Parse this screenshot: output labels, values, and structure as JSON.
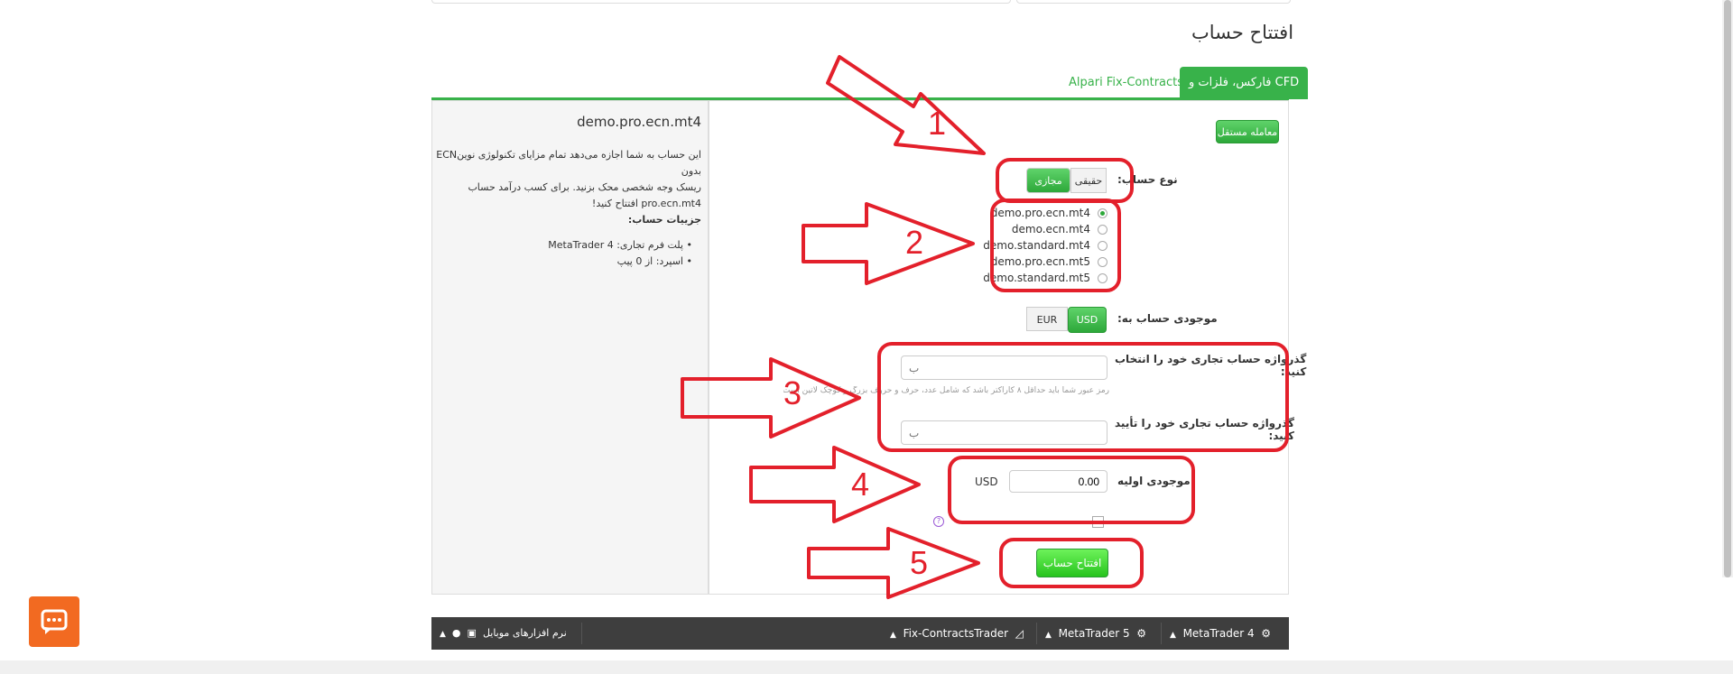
{
  "page": {
    "title": "افتتاح حساب"
  },
  "tabs": [
    {
      "label": "فارکس، فلزات و CFD",
      "active": true
    },
    {
      "label": "Alpari Fix-Contracts",
      "active": false
    }
  ],
  "trade_button": "معامله مستقل",
  "account_type": {
    "label": "نوع حساب:",
    "options": [
      "مجازی",
      "حقیقی"
    ],
    "selected": "مجازی"
  },
  "accounts": [
    {
      "label": "demo.pro.ecn.mt4",
      "selected": true
    },
    {
      "label": "demo.ecn.mt4",
      "selected": false
    },
    {
      "label": "demo.standard.mt4",
      "selected": false
    },
    {
      "label": "demo.pro.ecn.mt5",
      "selected": false
    },
    {
      "label": "demo.standard.mt5",
      "selected": false
    }
  ],
  "currency": {
    "label": "موجودی حساب به:",
    "options": [
      "USD",
      "EUR"
    ],
    "selected": "USD"
  },
  "password": {
    "label_line1": "گذرواژه حساب تجاری خود را انتخاب",
    "label_line2": "کنید:",
    "placeholder": "ب",
    "hint": "رمز عبور شما باید حداقل ۸ کاراکتر باشد که شامل عدد، حرف و حروف بزرگ و کوچک لاتین است."
  },
  "confirm_password": {
    "label_line1": "گذرواژه حساب تجاری خود را تأیید",
    "label_line2": "کنید:",
    "placeholder": "ب"
  },
  "initial_balance": {
    "label": "موجودی اولیه",
    "value": "0.00",
    "currency": "USD"
  },
  "submit_button": "افتتاح حساب",
  "annotations": [
    "1",
    "2",
    "3",
    "4",
    "5"
  ],
  "description": {
    "title": "demo.pro.ecn.mt4",
    "lines": [
      "این حساب به شما اجازه می‌دهد تمام مزایای تکنولوژی نوینECN بدون",
      "ریسک وجه شخصی محک بزنید. برای کسب درآمد حساب",
      "pro.ecn.mt4 افتتاح کنید!"
    ],
    "details_title": "جزییات حساب:",
    "details": [
      "پلت فرم تجاری: MetaTrader 4",
      "اسپرد: از 0 پیپ"
    ]
  },
  "bottom_bar": {
    "items": [
      "MetaTrader 4",
      "MetaTrader 5",
      "Fix-ContractsTrader",
      "نرم افزارهای موبایل"
    ]
  },
  "colors": {
    "accent": "#38b24a",
    "annotation": "#e3202b",
    "chat": "#f26a21",
    "bar": "#3e3e3e"
  }
}
